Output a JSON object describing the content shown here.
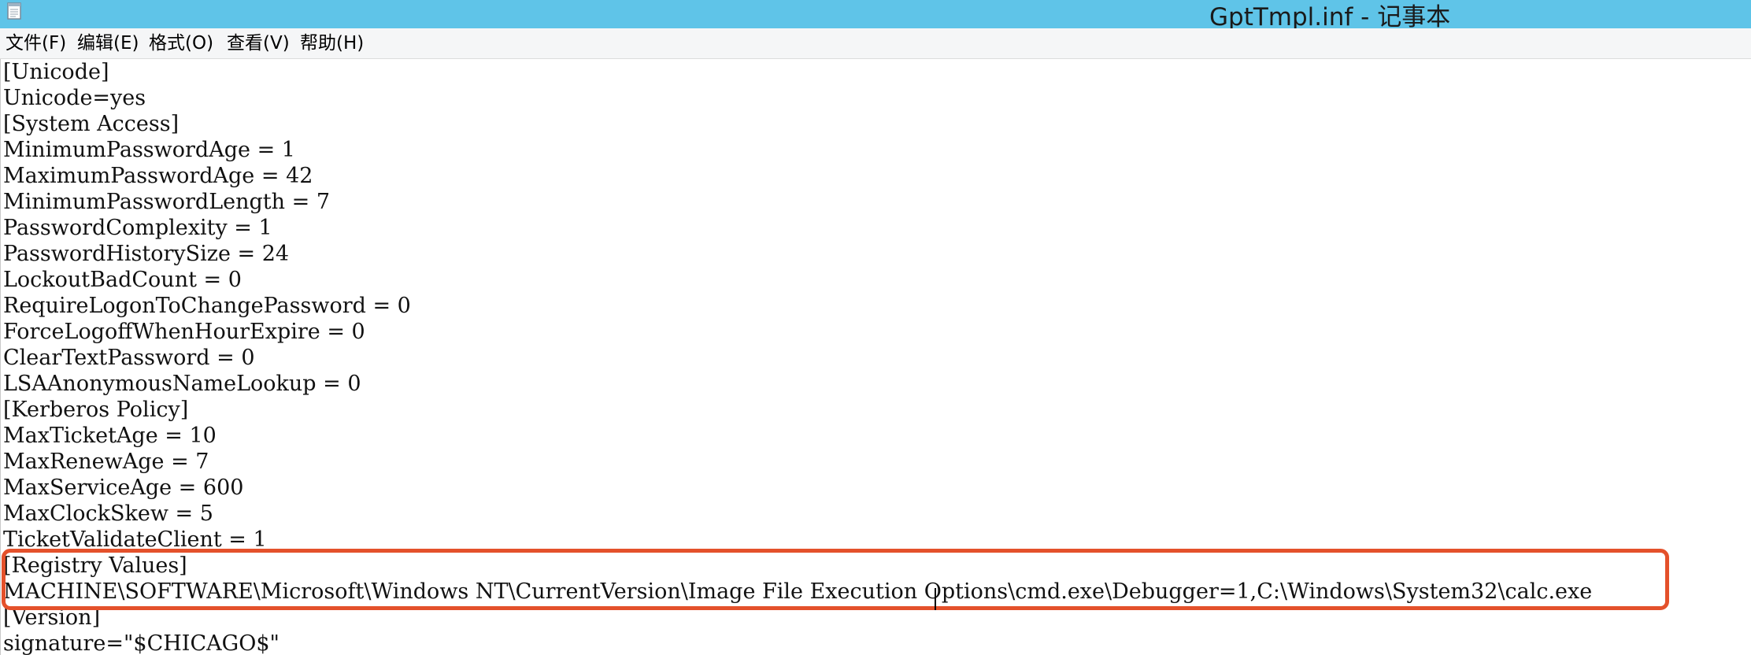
{
  "window": {
    "title": "GptTmpl.inf - 记事本"
  },
  "menu": {
    "file": "文件(F)",
    "edit": "编辑(E)",
    "format": "格式(O)",
    "view": "查看(V)",
    "help": "帮助(H)"
  },
  "editor": {
    "lines": [
      "[Unicode]",
      "Unicode=yes",
      "[System Access]",
      "MinimumPasswordAge = 1",
      "MaximumPasswordAge = 42",
      "MinimumPasswordLength = 7",
      "PasswordComplexity = 1",
      "PasswordHistorySize = 24",
      "LockoutBadCount = 0",
      "RequireLogonToChangePassword = 0",
      "ForceLogoffWhenHourExpire = 0",
      "ClearTextPassword = 0",
      "LSAAnonymousNameLookup = 0",
      "[Kerberos Policy]",
      "MaxTicketAge = 10",
      "MaxRenewAge = 7",
      "MaxServiceAge = 600",
      "MaxClockSkew = 5",
      "TicketValidateClient = 1",
      "[Registry Values]",
      "MACHINE\\SOFTWARE\\Microsoft\\Windows NT\\CurrentVersion\\Image File Execution Options\\cmd.exe\\Debugger=1,C:\\Windows\\System32\\calc.exe",
      "[Version]",
      "signature=\"$CHICAGO$\""
    ]
  },
  "colors": {
    "titlebar": "#5fc4e8",
    "highlight_box": "#e4512b"
  },
  "icons": {
    "app": "notepad-icon"
  }
}
